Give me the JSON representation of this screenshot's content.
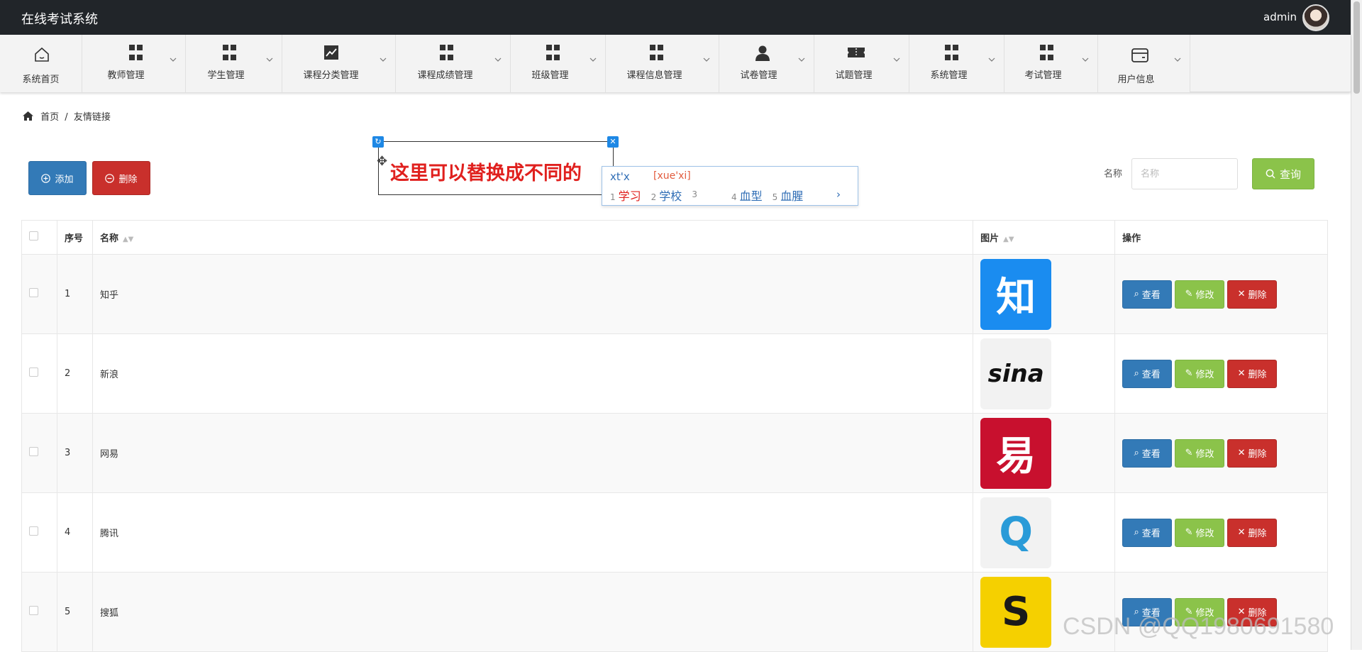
{
  "app": {
    "title": "在线考试系统",
    "user": "admin"
  },
  "nav": [
    {
      "label": "系统首页",
      "icon": "home-icon"
    },
    {
      "label": "教师管理",
      "icon": "grid-icon"
    },
    {
      "label": "学生管理",
      "icon": "grid-icon"
    },
    {
      "label": "课程分类管理",
      "icon": "chart-icon"
    },
    {
      "label": "课程成绩管理",
      "icon": "grid-icon"
    },
    {
      "label": "班级管理",
      "icon": "grid-icon"
    },
    {
      "label": "课程信息管理",
      "icon": "grid-icon"
    },
    {
      "label": "试卷管理",
      "icon": "user-icon"
    },
    {
      "label": "试题管理",
      "icon": "ticket-icon"
    },
    {
      "label": "系统管理",
      "icon": "grid-icon"
    },
    {
      "label": "考试管理",
      "icon": "grid-icon"
    },
    {
      "label": "用户信息",
      "icon": "card-icon"
    }
  ],
  "breadcrumb": {
    "home": "首页",
    "separator": "/",
    "current": "友情链接"
  },
  "toolbar": {
    "add_label": "添加",
    "delete_label": "删除"
  },
  "search": {
    "label": "名称",
    "placeholder": "名称",
    "button_label": "查询"
  },
  "overlay": {
    "text": "这里可以替换成不同的"
  },
  "ime": {
    "input": "xt'x",
    "pinyin": "[xue'xi]",
    "candidates": [
      {
        "num": "1",
        "text": "学习"
      },
      {
        "num": "2",
        "text": "学校"
      },
      {
        "num": "3",
        "text": ""
      },
      {
        "num": "4",
        "text": "血型"
      },
      {
        "num": "5",
        "text": "血腥"
      }
    ],
    "next": "›"
  },
  "table": {
    "headers": {
      "index": "序号",
      "name": "名称",
      "image": "图片",
      "actions": "操作"
    },
    "rows": [
      {
        "index": "1",
        "name": "知乎",
        "logo_text": "知",
        "logo_bg": "#1a8cf0",
        "logo_fg": "#ffffff"
      },
      {
        "index": "2",
        "name": "新浪",
        "logo_text": "sina",
        "logo_bg": "#f2f2f2",
        "logo_fg": "#111111"
      },
      {
        "index": "3",
        "name": "网易",
        "logo_text": "易",
        "logo_bg": "#c8102e",
        "logo_fg": "#ffffff"
      },
      {
        "index": "4",
        "name": "腾讯",
        "logo_text": "Q",
        "logo_bg": "#f2f2f2",
        "logo_fg": "#2a9bd8"
      },
      {
        "index": "5",
        "name": "搜狐",
        "logo_text": "S",
        "logo_bg": "#f5d000",
        "logo_fg": "#1a1a1a"
      }
    ],
    "actions": {
      "view": "查看",
      "edit": "修改",
      "delete": "删除"
    }
  },
  "watermark": "CSDN @QQ1980691580",
  "colors": {
    "topbar": "#212529",
    "primary": "#337ab7",
    "success": "#8bc34a",
    "danger": "#c9302c",
    "overlay_text": "#e0201e"
  }
}
